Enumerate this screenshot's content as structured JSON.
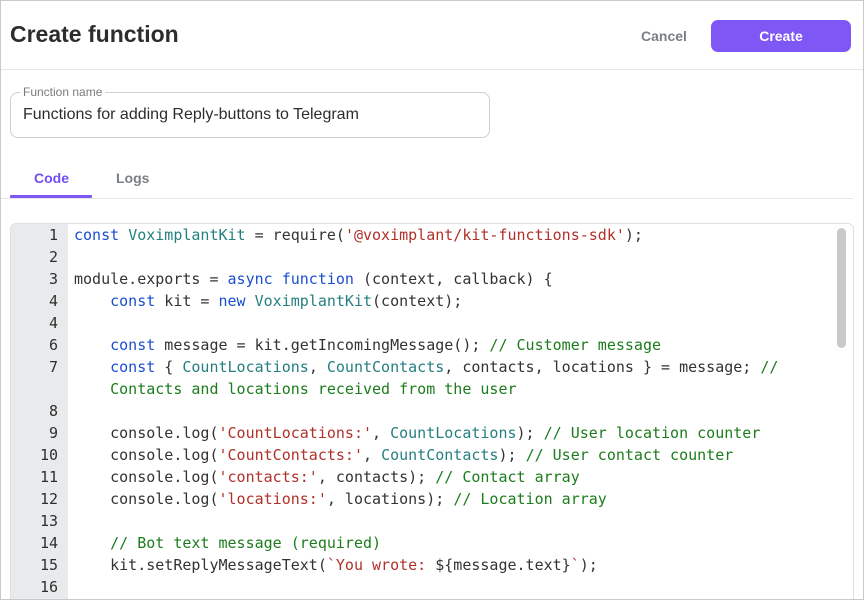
{
  "header": {
    "title": "Create function",
    "cancel_label": "Cancel",
    "create_label": "Create"
  },
  "form": {
    "function_name_label": "Function name",
    "function_name_value": "Functions for adding Reply-buttons to Telegram"
  },
  "tabs": [
    {
      "label": "Code",
      "active": true
    },
    {
      "label": "Logs",
      "active": false
    }
  ],
  "colors": {
    "accent": "#7e57f5",
    "keyword": "#1a4fcf",
    "class": "#267f80",
    "string": "#b0312a",
    "comment": "#1c7c1c"
  },
  "editor": {
    "lines": [
      {
        "n": "1",
        "tokens": [
          {
            "t": "const ",
            "c": "kw"
          },
          {
            "t": "VoximplantKit",
            "c": "cls"
          },
          {
            "t": " = require(",
            "c": ""
          },
          {
            "t": "'@voximplant/kit-functions-sdk'",
            "c": "str"
          },
          {
            "t": ");",
            "c": ""
          }
        ]
      },
      {
        "n": "2",
        "tokens": []
      },
      {
        "n": "3",
        "tokens": [
          {
            "t": "module.exports = ",
            "c": ""
          },
          {
            "t": "async function",
            "c": "kw"
          },
          {
            "t": " (context, callback) {",
            "c": ""
          }
        ]
      },
      {
        "n": "4",
        "tokens": [
          {
            "t": "    ",
            "c": ""
          },
          {
            "t": "const",
            "c": "kw"
          },
          {
            "t": " kit = ",
            "c": ""
          },
          {
            "t": "new",
            "c": "kw"
          },
          {
            "t": " ",
            "c": ""
          },
          {
            "t": "VoximplantKit",
            "c": "cls"
          },
          {
            "t": "(context);",
            "c": ""
          }
        ]
      },
      {
        "n": "4",
        "tokens": []
      },
      {
        "n": "6",
        "tokens": [
          {
            "t": "    ",
            "c": ""
          },
          {
            "t": "const",
            "c": "kw"
          },
          {
            "t": " message = kit.getIncomingMessage(); ",
            "c": ""
          },
          {
            "t": "// Customer message",
            "c": "cm"
          }
        ]
      },
      {
        "n": "7",
        "tokens": [
          {
            "t": "    ",
            "c": ""
          },
          {
            "t": "const",
            "c": "kw"
          },
          {
            "t": " { ",
            "c": ""
          },
          {
            "t": "CountLocations",
            "c": "cls"
          },
          {
            "t": ", ",
            "c": ""
          },
          {
            "t": "CountContacts",
            "c": "cls"
          },
          {
            "t": ", contacts, locations } = message; ",
            "c": ""
          },
          {
            "t": "//",
            "c": "cm"
          }
        ]
      },
      {
        "n": "",
        "tokens": [
          {
            "t": "    ",
            "c": ""
          },
          {
            "t": "Contacts and locations received from the user",
            "c": "cm"
          }
        ]
      },
      {
        "n": "8",
        "tokens": []
      },
      {
        "n": "9",
        "tokens": [
          {
            "t": "    console.log(",
            "c": ""
          },
          {
            "t": "'CountLocations:'",
            "c": "str"
          },
          {
            "t": ", ",
            "c": ""
          },
          {
            "t": "CountLocations",
            "c": "cls"
          },
          {
            "t": "); ",
            "c": ""
          },
          {
            "t": "// User location counter",
            "c": "cm"
          }
        ]
      },
      {
        "n": "10",
        "tokens": [
          {
            "t": "    console.log(",
            "c": ""
          },
          {
            "t": "'CountContacts:'",
            "c": "str"
          },
          {
            "t": ", ",
            "c": ""
          },
          {
            "t": "CountContacts",
            "c": "cls"
          },
          {
            "t": "); ",
            "c": ""
          },
          {
            "t": "// User contact counter",
            "c": "cm"
          }
        ]
      },
      {
        "n": "11",
        "tokens": [
          {
            "t": "    console.log(",
            "c": ""
          },
          {
            "t": "'contacts:'",
            "c": "str"
          },
          {
            "t": ", contacts); ",
            "c": ""
          },
          {
            "t": "// Contact array",
            "c": "cm"
          }
        ]
      },
      {
        "n": "12",
        "tokens": [
          {
            "t": "    console.log(",
            "c": ""
          },
          {
            "t": "'locations:'",
            "c": "str"
          },
          {
            "t": ", locations); ",
            "c": ""
          },
          {
            "t": "// Location array",
            "c": "cm"
          }
        ]
      },
      {
        "n": "13",
        "tokens": []
      },
      {
        "n": "14",
        "tokens": [
          {
            "t": "    ",
            "c": ""
          },
          {
            "t": "// Bot text message (required)",
            "c": "cm"
          }
        ]
      },
      {
        "n": "15",
        "tokens": [
          {
            "t": "    kit.setReplyMessageText(",
            "c": ""
          },
          {
            "t": "`You wrote: ",
            "c": "str"
          },
          {
            "t": "${message.text}",
            "c": ""
          },
          {
            "t": "`",
            "c": "str"
          },
          {
            "t": ");",
            "c": ""
          }
        ]
      },
      {
        "n": "16",
        "tokens": []
      }
    ]
  }
}
